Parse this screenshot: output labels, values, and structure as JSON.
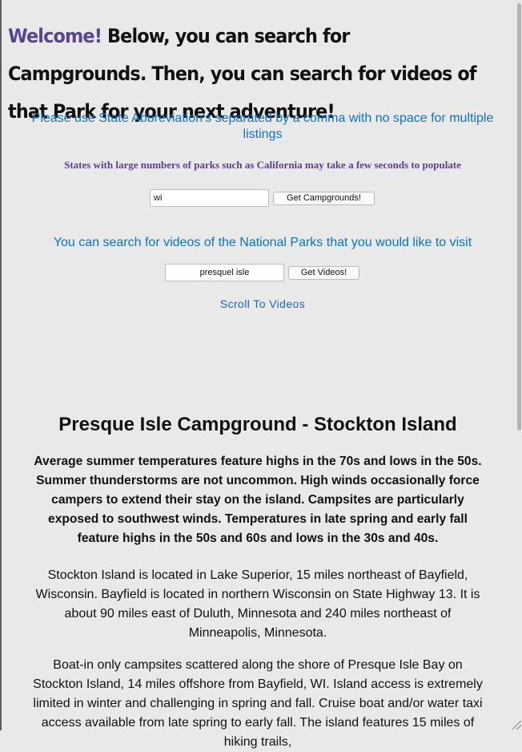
{
  "header": {
    "welcome": "Welcome!",
    "headline": " Below, you can search for Campgrounds. Then, you can search for videos of that Park for your next adventure!"
  },
  "campground_search": {
    "instruction": "Please use State Abbreviation's separated by a comma with no space for multiple listings",
    "note": "States with large numbers of parks such as California may take a few seconds to populate",
    "input_value": "wi",
    "button_label": "Get Campgrounds!"
  },
  "video_search": {
    "instruction": "You can search for videos of the National Parks that you would like to visit",
    "input_value": "presquel isle",
    "button_label": "Get Videos!",
    "scroll_link": "Scroll To Videos"
  },
  "campground": {
    "title": "Presque Isle Campground - Stockton Island",
    "weather": "Average summer temperatures feature highs in the 70s and lows in the 50s. Summer thunderstorms are not uncommon. High winds occasionally force campers to extend their stay on the island. Campsites are particularly exposed to southwest winds. Temperatures in late spring and early fall feature highs in the 50s and 60s and lows in the 30s and 40s.",
    "location": "Stockton Island is located in Lake Superior, 15 miles northeast of Bayfield, Wisconsin. Bayfield is located in northern Wisconsin on State Highway 13. It is about 90 miles east of Duluth, Minnesota and 240 miles northeast of Minneapolis, Minnesota.",
    "description": "Boat-in only campsites scattered along the shore of Presque Isle Bay on Stockton Island, 14 miles offshore from Bayfield, WI. Island access is extremely limited in winter and challenging in spring and fall. Cruise boat and/or water taxi access available from late spring to early fall. The island features 15 miles of hiking trails,"
  }
}
